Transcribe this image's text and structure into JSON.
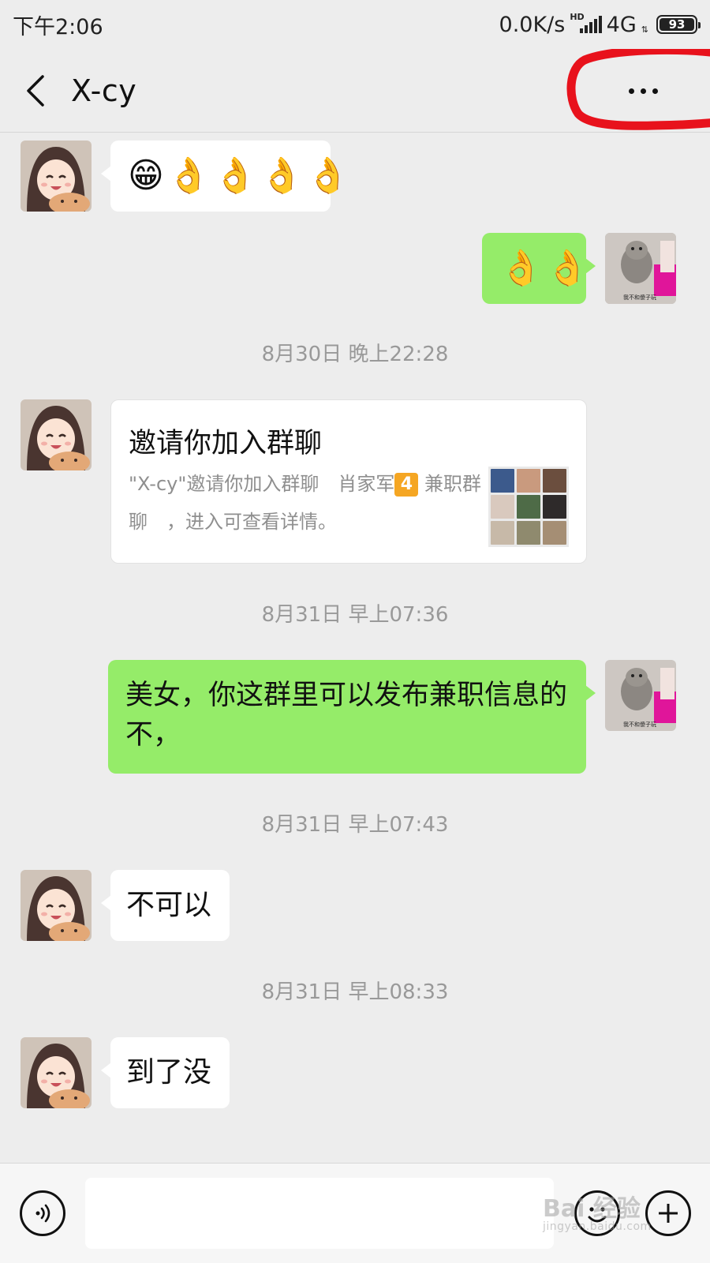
{
  "status_bar": {
    "time": "下午2:06",
    "network_speed": "0.0K/s",
    "hd_label": "HD",
    "network_type": "4G",
    "battery_percent": "93"
  },
  "header": {
    "title": "X-cy"
  },
  "messages": [
    {
      "side": "left",
      "type": "emoji",
      "emojis": [
        "😁",
        "👌",
        "👌",
        "👌",
        "👌"
      ]
    },
    {
      "side": "right",
      "type": "emoji",
      "emojis": [
        "👌",
        "👌"
      ]
    },
    {
      "type": "timestamp",
      "text": "8月30日 晚上22:28"
    },
    {
      "side": "left",
      "type": "group_invite",
      "title": "邀请你加入群聊",
      "desc_before_badge": "\"X-cy\"邀请你加入群聊　肖家军",
      "badge": "4",
      "desc_after_badge": " 兼职群聊　，进入可查看详情。"
    },
    {
      "type": "timestamp",
      "text": "8月31日 早上07:36"
    },
    {
      "side": "right",
      "type": "text",
      "text": "美女，你这群里可以发布兼职信息的不，"
    },
    {
      "type": "timestamp",
      "text": "8月31日 早上07:43"
    },
    {
      "side": "left",
      "type": "text",
      "text": "不可以"
    },
    {
      "type": "timestamp",
      "text": "8月31日 早上08:33"
    },
    {
      "side": "left",
      "type": "text",
      "text": "到了没"
    }
  ],
  "self_avatar_caption": "我不和傻子玩",
  "watermark": {
    "text": "Bai 经验",
    "url_text": "jingyan.baidu.com"
  },
  "colors": {
    "background": "#ededed",
    "self_bubble": "#95ec69",
    "other_bubble": "#ffffff",
    "annotation_red": "#e8121c"
  }
}
